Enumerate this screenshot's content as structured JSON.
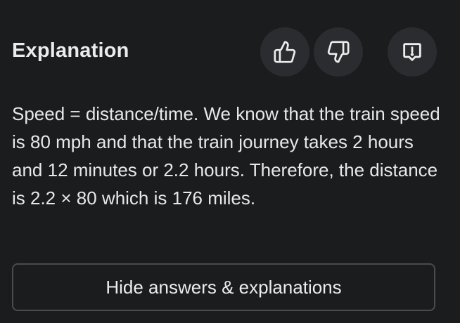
{
  "explanation": {
    "heading": "Explanation",
    "body": "Speed = distance/time. We know that the train speed is 80 mph and that the train journey takes 2 hours and 12 minutes or 2.2 hours. Therefore, the distance is 2.2 × 80 which is 176 miles."
  },
  "actions": {
    "thumbs_up_icon": "thumbs-up-icon",
    "thumbs_down_icon": "thumbs-down-icon",
    "report_icon": "report-icon"
  },
  "footer": {
    "hide_label": "Hide answers & explanations"
  },
  "colors": {
    "background": "#1b1c1e",
    "icon_button_bg": "#2b2c2f",
    "text": "#ececec",
    "border": "#4a4b4e"
  }
}
